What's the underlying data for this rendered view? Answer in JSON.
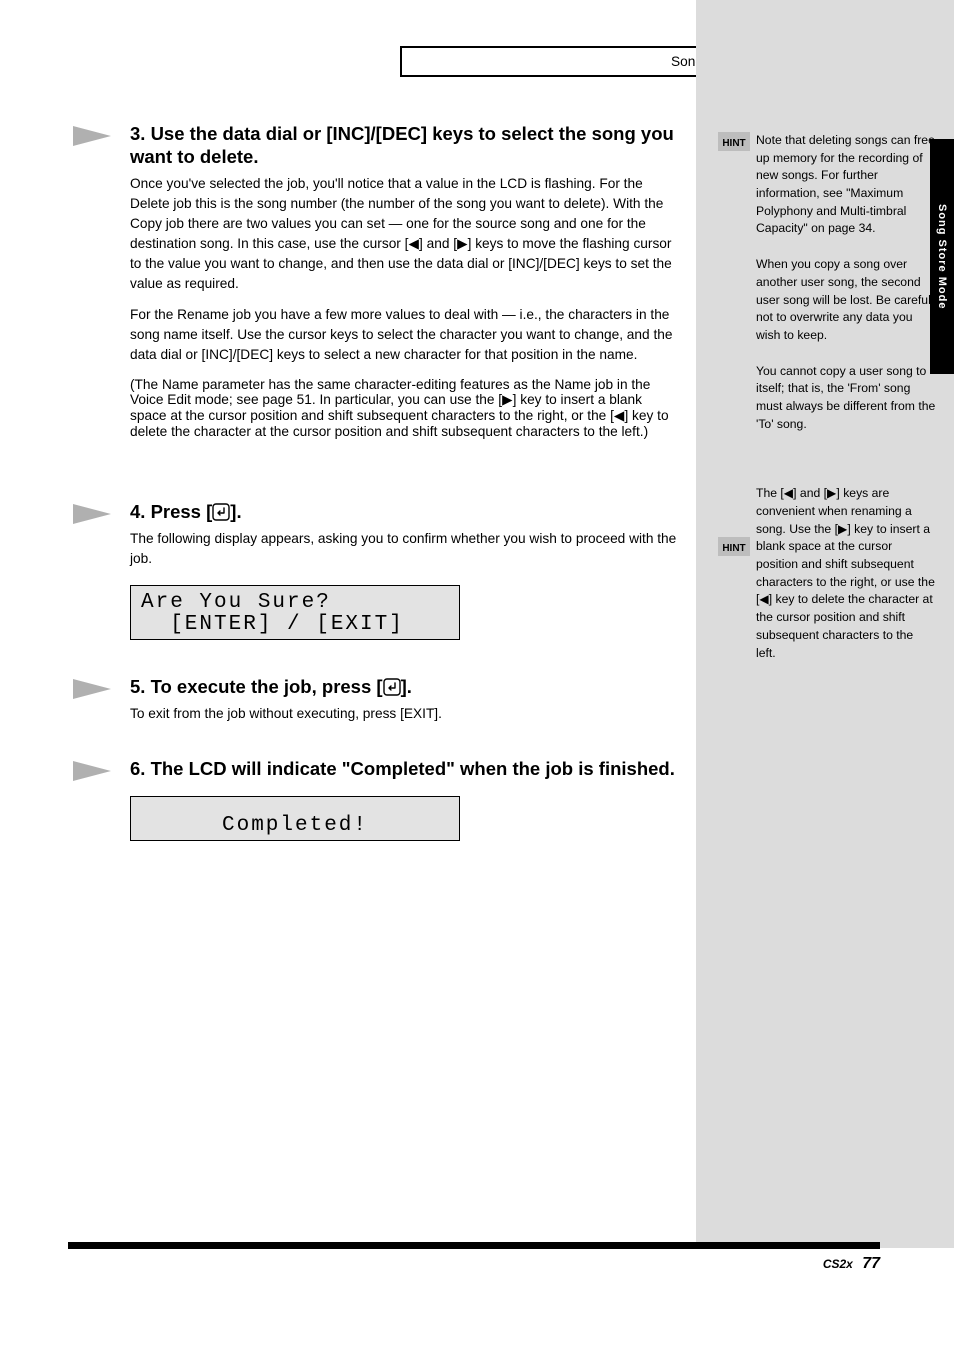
{
  "breadcrumb": "Song Store Mode | Song Delete",
  "side_tab": "Song Store Mode",
  "steps": {
    "s3": {
      "head": "3. Use the data dial or [INC]/[DEC] keys to select the song you want to delete.",
      "body1_a": "Once you've selected the job, you'll notice that a value in the LCD is flashing. For the Delete job this is the song number (the number of the song you want to delete). With the Copy job there are two values you can set — one for the source song and one for the destination song. In this case, use the cursor [",
      "body1_b": "] and [",
      "body1_c": "] keys to move the flashing cursor to the value you want to change, and then use the data dial or [INC]/[DEC] keys to set the value as required.",
      "body2": "For the Rename job you have a few more values to deal with — i.e., the characters in the song name itself. Use the cursor keys to select the character you want to change, and the data dial or [INC]/[DEC] keys to select a new character for that position in the name.",
      "paren_a": "(The Name parameter has the same character-editing features as the Name job in the Voice Edit mode; see page 51. In particular, you can use the [",
      "paren_b": "] key to insert a blank space at the cursor position and shift subsequent characters to the right, or the [",
      "paren_c": "] key to delete the character at the cursor position and shift subsequent characters to the left.)"
    },
    "s4": {
      "head_a": "4. Press [",
      "head_b": "].",
      "body": "The following display appears, asking you to confirm whether you wish to proceed with the job."
    },
    "s5": {
      "head_a": "5. To execute the job, press [",
      "head_b": "].",
      "body": "To exit from the job without executing, press [EXIT]."
    },
    "s6": {
      "head": "6. The LCD will indicate \"Completed\" when the job is finished."
    }
  },
  "lcd": {
    "confirm_line1": "Are You Sure?",
    "confirm_line2": "  [ENTER] / [EXIT]",
    "completed": "Completed!"
  },
  "hints": {
    "h1": "Note that deleting songs can free up memory for the recording of new songs. For further information, see \"Maximum Polyphony and Multi-timbral Capacity\" on page 34.",
    "h2": "When you copy a song over another user song, the second user song will be lost. Be careful not to overwrite any data you wish to keep.",
    "h3": "You cannot copy a user song to itself; that is, the 'From' song must always be different from the 'To' song.",
    "h4a": "The [",
    "h4b": "] and [",
    "h4c": "] keys are convenient when renaming a song. Use the [",
    "h4d": "] key to insert a blank space at the cursor position and shift subsequent characters to the right, or use the [",
    "h4e": "] key to delete the character at the cursor position and shift subsequent characters to the left."
  },
  "footer": {
    "model": "CS2x",
    "page": "77"
  }
}
